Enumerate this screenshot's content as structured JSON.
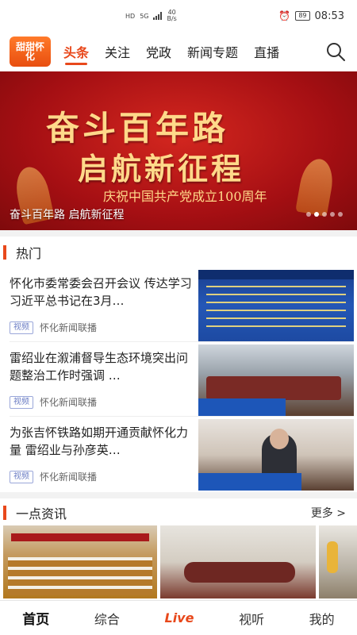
{
  "status_bar": {
    "hd": "HD",
    "network": "5G",
    "net_speed_value": "40",
    "net_speed_unit": "B/s",
    "battery": "89",
    "time": "08:53"
  },
  "header": {
    "logo_text": "甜甜怀化",
    "tabs": [
      {
        "label": "头条",
        "active": true
      },
      {
        "label": "关注"
      },
      {
        "label": "党政"
      },
      {
        "label": "新闻专题"
      },
      {
        "label": "直播"
      }
    ]
  },
  "banner": {
    "line1": "奋斗百年路",
    "line2": "启航新征程",
    "subtitle": "庆祝中国共产党成立100周年",
    "caption": "奋斗百年路 启航新征程",
    "slide_count": 5,
    "active_slide": 1
  },
  "hot_section": {
    "title": "热门",
    "items": [
      {
        "title": "怀化市委常委会召开会议 传达学习习近平总书记在3月…",
        "tag": "视频",
        "source": "怀化新闻联播"
      },
      {
        "title": "雷绍业在溆浦督导生态环境突出问题整治工作时强调 …",
        "tag": "视频",
        "source": "怀化新闻联播"
      },
      {
        "title": "为张吉怀铁路如期开通贡献怀化力量 雷绍业与孙彦英…",
        "tag": "视频",
        "source": "怀化新闻联播"
      }
    ]
  },
  "info_section": {
    "title": "一点资讯",
    "more": "更多 >"
  },
  "bottom_nav": {
    "items": [
      {
        "label": "首页",
        "active": true
      },
      {
        "label": "综合"
      },
      {
        "label": "Live"
      },
      {
        "label": "视听"
      },
      {
        "label": "我的"
      }
    ]
  },
  "colors": {
    "accent": "#e8481b",
    "banner_red": "#a50f13",
    "tag_blue": "#6a7cc4"
  },
  "icons": {
    "search": "search-icon",
    "alarm": "alarm-icon",
    "signal": "signal-icon",
    "battery": "battery-icon"
  }
}
